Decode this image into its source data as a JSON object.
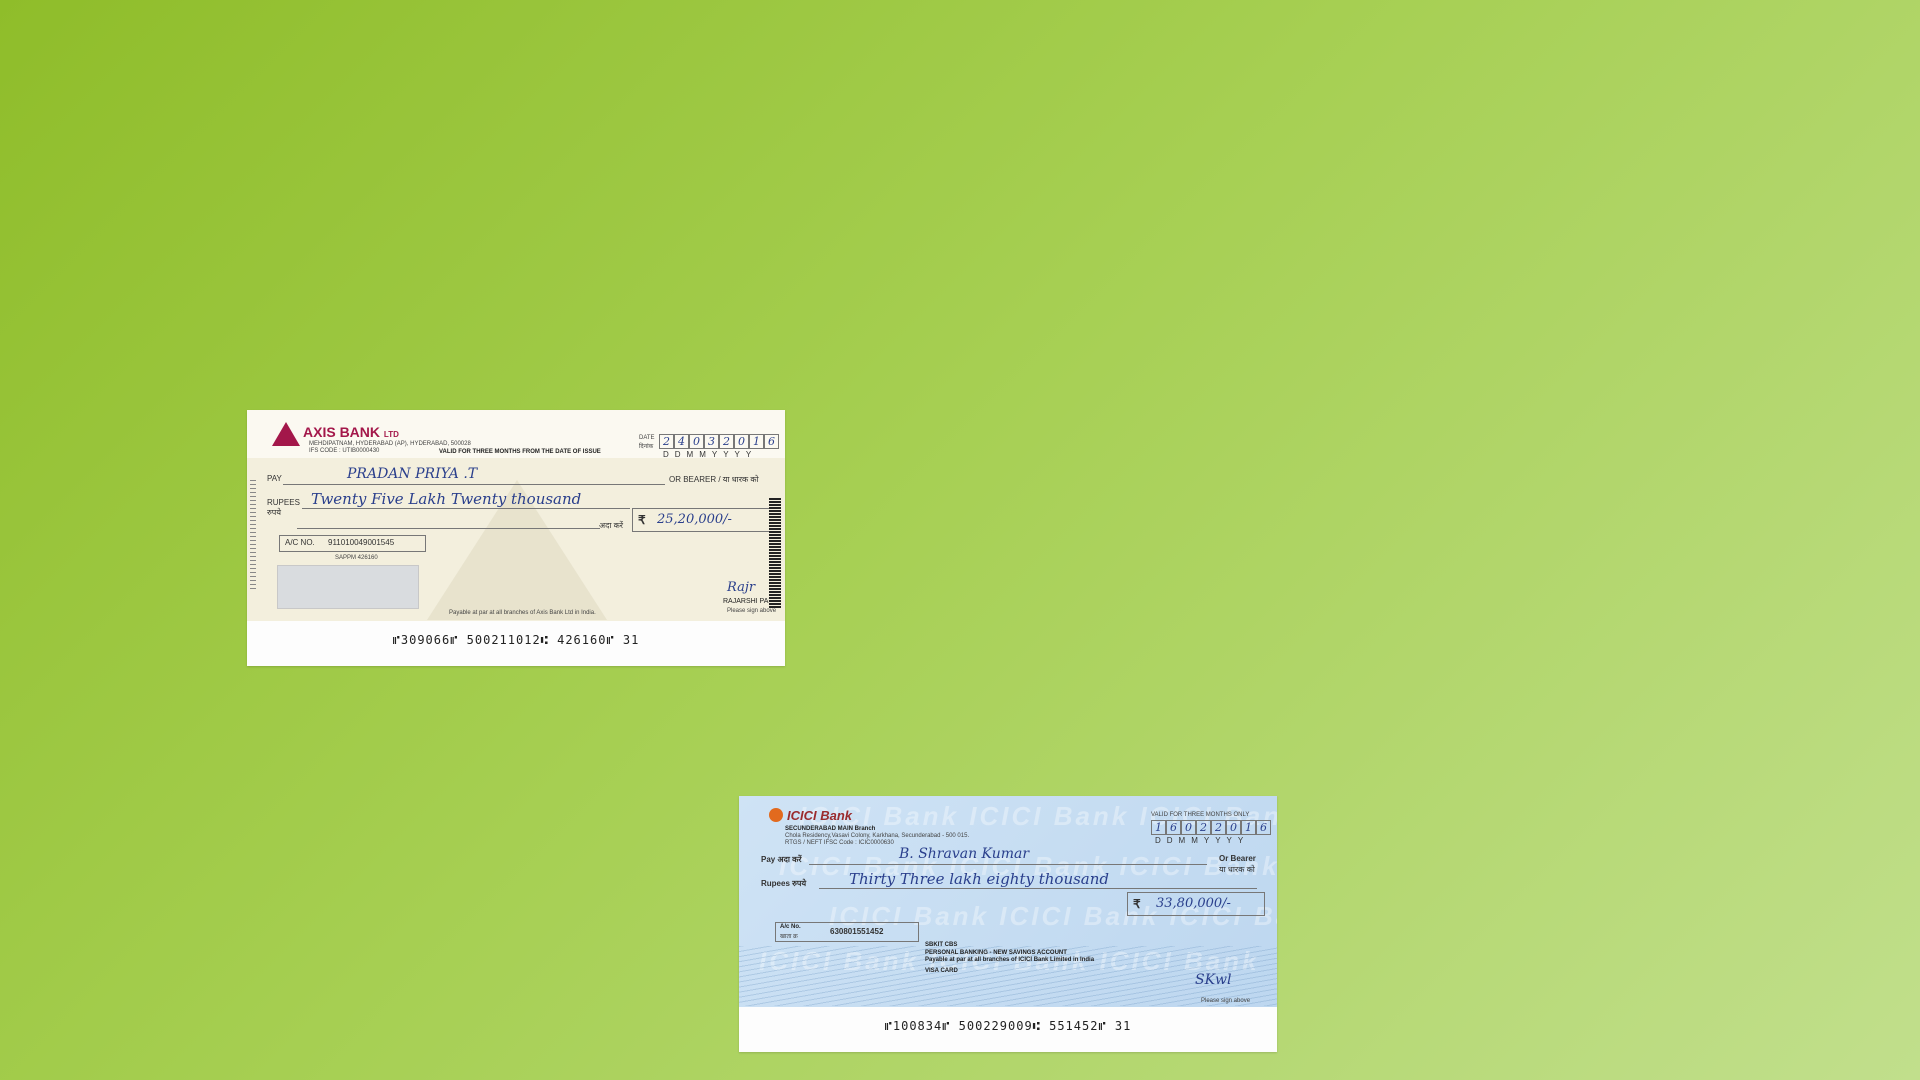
{
  "axis": {
    "bank": "AXIS BANK",
    "bank_suffix": "LTD",
    "branch": "MEHDIPATNAM, HYDERABAD (AP), HYDERABAD, 500028",
    "ifsc": "IFS CODE : UTIB0000430",
    "validity": "VALID FOR THREE MONTHS FROM THE DATE OF ISSUE",
    "date_label": "DATE",
    "date_label_hi": "दिनांक",
    "date_digits": [
      "2",
      "4",
      "0",
      "3",
      "2",
      "0",
      "1",
      "6"
    ],
    "date_format": "DDMMYYYY",
    "pay_label": "PAY",
    "payee": "PRADAN PRIYA .T",
    "bearer_label": "OR BEARER / या धारक को",
    "rupees_label": "RUPEES",
    "rupees_label_hi": "रुपये",
    "amount_words": "Twenty Five Lakh Twenty thousand",
    "ada_karen": "अदा करें",
    "rupee_symbol": "₹",
    "amount_figures": "25,20,000/-",
    "ac_label": "A/C NO.",
    "ac_number": "911010049001545",
    "ac_sub": "SAPPM 426160",
    "payable": "Payable at par at all branches of Axis Bank Ltd in India.",
    "signatory": "RAJARSHI PAL",
    "sign_here": "Please sign above",
    "micr": "⑈309066⑈ 500211012⑆ 426160⑈ 31"
  },
  "icici": {
    "bank": "ICICI Bank",
    "branch": "SECUNDERABAD MAIN Branch",
    "address": "Chola Residency,Vasavi Colony, Karkhana, Secunderabad - 500 015.",
    "ifsc": "RTGS / NEFT IFSC Code : ICIC0000630",
    "validity": "VALID FOR THREE MONTHS ONLY",
    "date_digits": [
      "1",
      "6",
      "0",
      "2",
      "2",
      "0",
      "1",
      "6"
    ],
    "date_format": "DDMMYYYY",
    "pay_label": "Pay अदा करें",
    "payee": "B. Shravan Kumar",
    "bearer_label": "Or Bearer",
    "bearer_label_hi": "या धारक को",
    "rupees_label": "Rupees रुपये",
    "amount_words": "Thirty Three lakh eighty thousand",
    "rupee_symbol": "₹",
    "amount_figures": "33,80,000/-",
    "ac_label": "A/c No.",
    "ac_label_hi": "खाता क्र",
    "ac_number": "630801551452",
    "sb_line": "SBKIT CBS",
    "account_type": "PERSONAL BANKING - NEW SAVINGS ACCOUNT",
    "payable": "Payable at par at all branches of ICICI Bank Limited in India",
    "visa": "VISA CARD",
    "bg_text": "ICICI Bank ICICI Bank ICICI Bank",
    "sign_here": "Please sign above",
    "micr": "⑈100834⑈ 500229009⑆ 551452⑈ 31"
  }
}
